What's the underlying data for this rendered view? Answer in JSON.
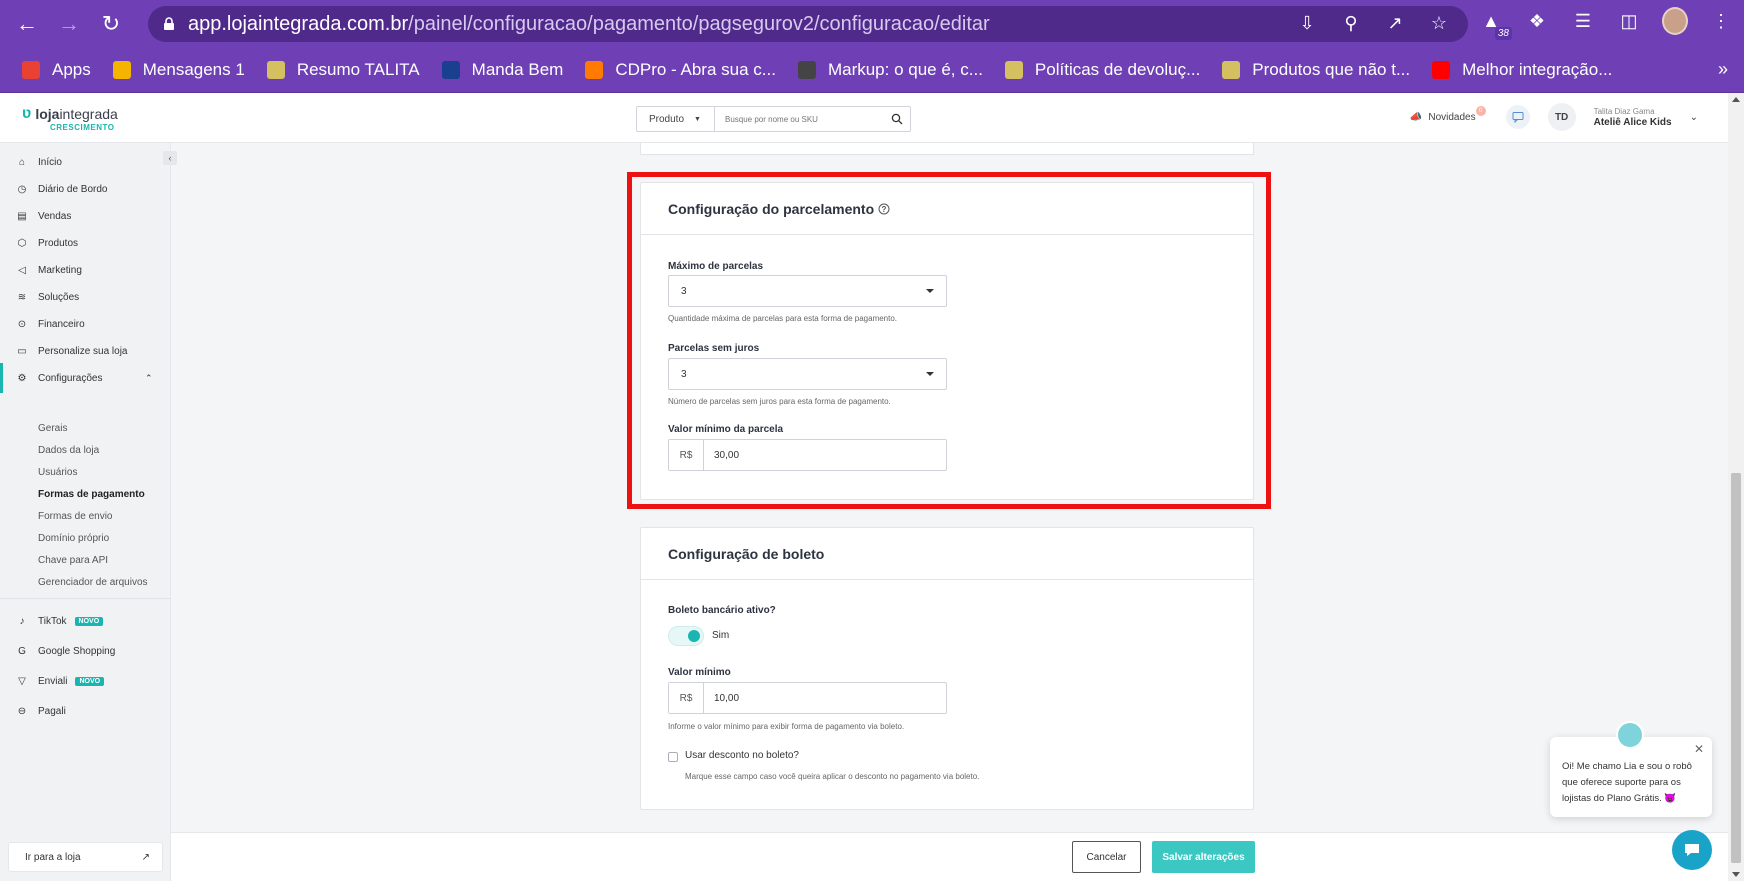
{
  "browser": {
    "url_host": "app.lojaintegrada.com.br",
    "url_path": "/painel/configuracao/pagamento/pagsegurov2/configuracao/editar",
    "extension_badge": "38",
    "bookmarks": [
      {
        "label": "Apps",
        "icon": "apps-grid-icon",
        "color": "#e94235"
      },
      {
        "label": "Mensagens 1",
        "icon": "message-icon",
        "color": "#f4b400"
      },
      {
        "label": "Resumo TALITA",
        "icon": "hat-icon",
        "color": "#d4c060"
      },
      {
        "label": "Manda Bem",
        "icon": "mb-logo-icon",
        "color": "#1a3f8f"
      },
      {
        "label": "CDPro - Abra sua c...",
        "icon": "inter-logo-icon",
        "color": "#ff7a00"
      },
      {
        "label": "Markup: o que é, c...",
        "icon": "site-icon",
        "color": "#444444"
      },
      {
        "label": "Políticas de devoluç...",
        "icon": "hat-icon",
        "color": "#d4c060"
      },
      {
        "label": "Produtos que não t...",
        "icon": "hat-icon",
        "color": "#d4c060"
      },
      {
        "label": "Melhor integração...",
        "icon": "youtube-icon",
        "color": "#ff0000"
      }
    ]
  },
  "header": {
    "logo_main_a": "loja",
    "logo_main_b": "integrada",
    "logo_sub": "CRESCIMENTO",
    "search_select": "Produto",
    "search_placeholder": "Busque por nome ou SKU",
    "novidades": "Novidades",
    "novidades_badge": "0",
    "user_initials": "TD",
    "user_role": "Talita Diaz Gama",
    "user_store": "Ateliê Alice Kids"
  },
  "sidebar": {
    "items": [
      {
        "label": "Início",
        "icon": "home-icon"
      },
      {
        "label": "Diário de Bordo",
        "icon": "compass-icon"
      },
      {
        "label": "Vendas",
        "icon": "receipt-icon"
      },
      {
        "label": "Produtos",
        "icon": "box-icon"
      },
      {
        "label": "Marketing",
        "icon": "megaphone-icon"
      },
      {
        "label": "Soluções",
        "icon": "layers-icon"
      },
      {
        "label": "Financeiro",
        "icon": "money-icon"
      },
      {
        "label": "Personalize sua loja",
        "icon": "monitor-icon"
      },
      {
        "label": "Configurações",
        "icon": "gear-icon"
      }
    ],
    "sub_items": [
      {
        "label": "Gerais"
      },
      {
        "label": "Dados da loja"
      },
      {
        "label": "Usuários"
      },
      {
        "label": "Formas de pagamento"
      },
      {
        "label": "Formas de envio"
      },
      {
        "label": "Domínio próprio"
      },
      {
        "label": "Chave para API"
      },
      {
        "label": "Gerenciador de arquivos"
      }
    ],
    "apps": [
      {
        "label": "TikTok",
        "icon": "tiktok-icon",
        "tag": "NOVO"
      },
      {
        "label": "Google Shopping",
        "icon": "google-icon",
        "tag": ""
      },
      {
        "label": "Enviali",
        "icon": "enviali-icon",
        "tag": "NOVO"
      },
      {
        "label": "Pagali",
        "icon": "pagali-icon",
        "tag": ""
      }
    ],
    "go_store": "Ir para a loja"
  },
  "parcelamento": {
    "title": "Configuração do parcelamento",
    "max_label": "Máximo de parcelas",
    "max_value": "3",
    "max_hint": "Quantidade máxima de parcelas para esta forma de pagamento.",
    "sem_juros_label": "Parcelas sem juros",
    "sem_juros_value": "3",
    "sem_juros_hint": "Número de parcelas sem juros para esta forma de pagamento.",
    "min_label": "Valor mínimo da parcela",
    "min_prefix": "R$",
    "min_value": "30,00"
  },
  "boleto": {
    "title": "Configuração de boleto",
    "active_label": "Boleto bancário ativo?",
    "active_value": "Sim",
    "min_label": "Valor mínimo",
    "min_prefix": "R$",
    "min_value": "10,00",
    "min_hint": "Informe o valor mínimo para exibir forma de pagamento via boleto.",
    "discount_label": "Usar desconto no boleto?",
    "discount_hint": "Marque esse campo caso você queira aplicar o desconto no pagamento via boleto."
  },
  "footer": {
    "cancel": "Cancelar",
    "save": "Salvar alterações"
  },
  "chat": {
    "message": "Oi! Me chamo Lia e sou o robô que oferece suporte para os lojistas do Plano Grátis. 😈"
  },
  "colors": {
    "accent": "#1ab5b0",
    "highlight": "#ee1111",
    "browser": "#6f3fb5"
  }
}
